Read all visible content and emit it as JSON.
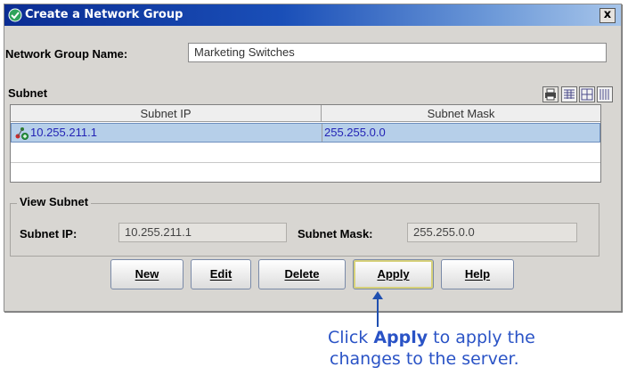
{
  "window": {
    "title": "Create a Network Group",
    "close_label": "x"
  },
  "form": {
    "group_name_label": "Network Group Name:",
    "group_name_value": "Marketing Switches"
  },
  "subnet_table": {
    "section_label": "Subnet",
    "columns": [
      "Subnet IP",
      "Subnet Mask"
    ],
    "rows": [
      {
        "ip": "10.255.211.1",
        "mask": "255.255.0.0"
      }
    ],
    "toolbar_icons": [
      "print-icon",
      "table-view-icon",
      "grid-view-icon",
      "column-view-icon"
    ]
  },
  "view_subnet": {
    "title": "View Subnet",
    "ip_label": "Subnet IP:",
    "ip_value": "10.255.211.1",
    "mask_label": "Subnet Mask:",
    "mask_value": "255.255.0.0"
  },
  "buttons": {
    "new": "New",
    "edit": "Edit",
    "delete": "Delete",
    "apply": "Apply",
    "help": "Help"
  },
  "callout": {
    "line1_pre": "Click ",
    "line1_bold": "Apply",
    "line1_post": " to apply the",
    "line2": "changes to the server."
  },
  "colors": {
    "title_bar": "#0b2d93",
    "selection": "#b6cfe9",
    "callout_text": "#2a53c6"
  }
}
